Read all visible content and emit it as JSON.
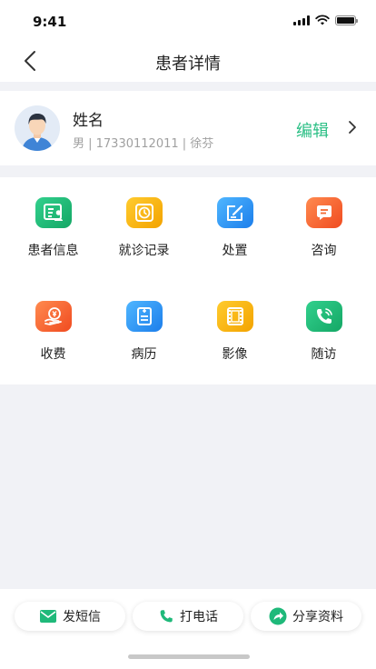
{
  "status_bar": {
    "time": "9:41"
  },
  "nav": {
    "title": "患者详情"
  },
  "patient": {
    "name": "姓名",
    "meta": "男 | 17330112011 | 徐芬",
    "edit_label": "编辑"
  },
  "menu": [
    {
      "label": "患者信息",
      "icon": "patient-info-icon",
      "color": "#1fb97a"
    },
    {
      "label": "就诊记录",
      "icon": "visit-record-icon",
      "color": "#f5b300"
    },
    {
      "label": "处置",
      "icon": "treatment-icon",
      "color": "#2d8df0"
    },
    {
      "label": "咨询",
      "icon": "consult-icon",
      "color": "#f56432"
    },
    {
      "label": "收费",
      "icon": "fee-icon",
      "color": "#f56432"
    },
    {
      "label": "病历",
      "icon": "medical-record-icon",
      "color": "#2d8df0"
    },
    {
      "label": "影像",
      "icon": "imaging-icon",
      "color": "#f5b300"
    },
    {
      "label": "随访",
      "icon": "follow-up-icon",
      "color": "#1fb97a"
    }
  ],
  "actions": {
    "sms_label": "发短信",
    "call_label": "打电话",
    "share_label": "分享资料"
  },
  "colors": {
    "accent": "#2bbf85"
  }
}
